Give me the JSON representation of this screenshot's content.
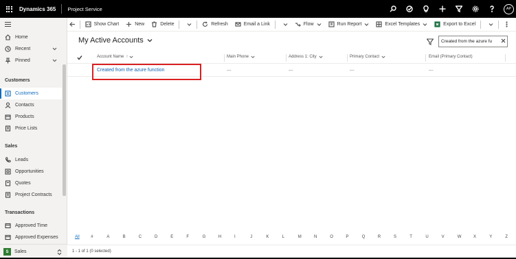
{
  "topbar": {
    "app_title": "Dynamics 365",
    "module": "Project Service",
    "avatar_initials": "AP",
    "icons": [
      "search-icon",
      "task-check-icon",
      "lightbulb-icon",
      "plus-icon",
      "filter-icon",
      "gear-icon",
      "help-icon"
    ]
  },
  "sidebar": {
    "items": {
      "home": "Home",
      "recent": "Recent",
      "pinned": "Pinned",
      "customers": "Customers",
      "contacts": "Contacts",
      "products": "Products",
      "price_lists": "Price Lists",
      "leads": "Leads",
      "opportunities": "Opportunities",
      "quotes": "Quotes",
      "project_contracts": "Project Contracts",
      "approved_time": "Approved Time",
      "approved_expenses": "Approved Expenses"
    },
    "sections": {
      "customers": "Customers",
      "sales": "Sales",
      "transactions": "Transactions"
    },
    "area": {
      "badge": "S",
      "label": "Sales"
    }
  },
  "commandbar": {
    "show_chart": "Show Chart",
    "new": "New",
    "delete": "Delete",
    "refresh": "Refresh",
    "email_link": "Email a Link",
    "flow": "Flow",
    "run_report": "Run Report",
    "excel_templates": "Excel Templates",
    "export_excel": "Export to Excel"
  },
  "view": {
    "title": "My Active Accounts",
    "search_value": "Created from the azure fu"
  },
  "grid": {
    "columns": {
      "account_name": "Account Name",
      "sort_indicator": "↑",
      "main_phone": "Main Phone",
      "city": "Address 1: City",
      "primary_contact": "Primary Contact",
      "email": "Email (Primary Contact)"
    },
    "row": {
      "account_name": "Created from the azure function",
      "main_phone": "---",
      "city": "---",
      "primary_contact": "---",
      "email": "---"
    }
  },
  "jumpbar": [
    "All",
    "#",
    "A",
    "B",
    "C",
    "D",
    "E",
    "F",
    "G",
    "H",
    "I",
    "J",
    "K",
    "L",
    "M",
    "N",
    "O",
    "P",
    "Q",
    "R",
    "S",
    "T",
    "U",
    "V",
    "W",
    "X",
    "Y",
    "Z"
  ],
  "status": {
    "text": "1 - 1 of 1 (0 selected)"
  },
  "colors": {
    "topbar": "#000000",
    "accent": "#0f6cbd",
    "highlight": "#d92020",
    "area_badge": "#2e7d32"
  }
}
